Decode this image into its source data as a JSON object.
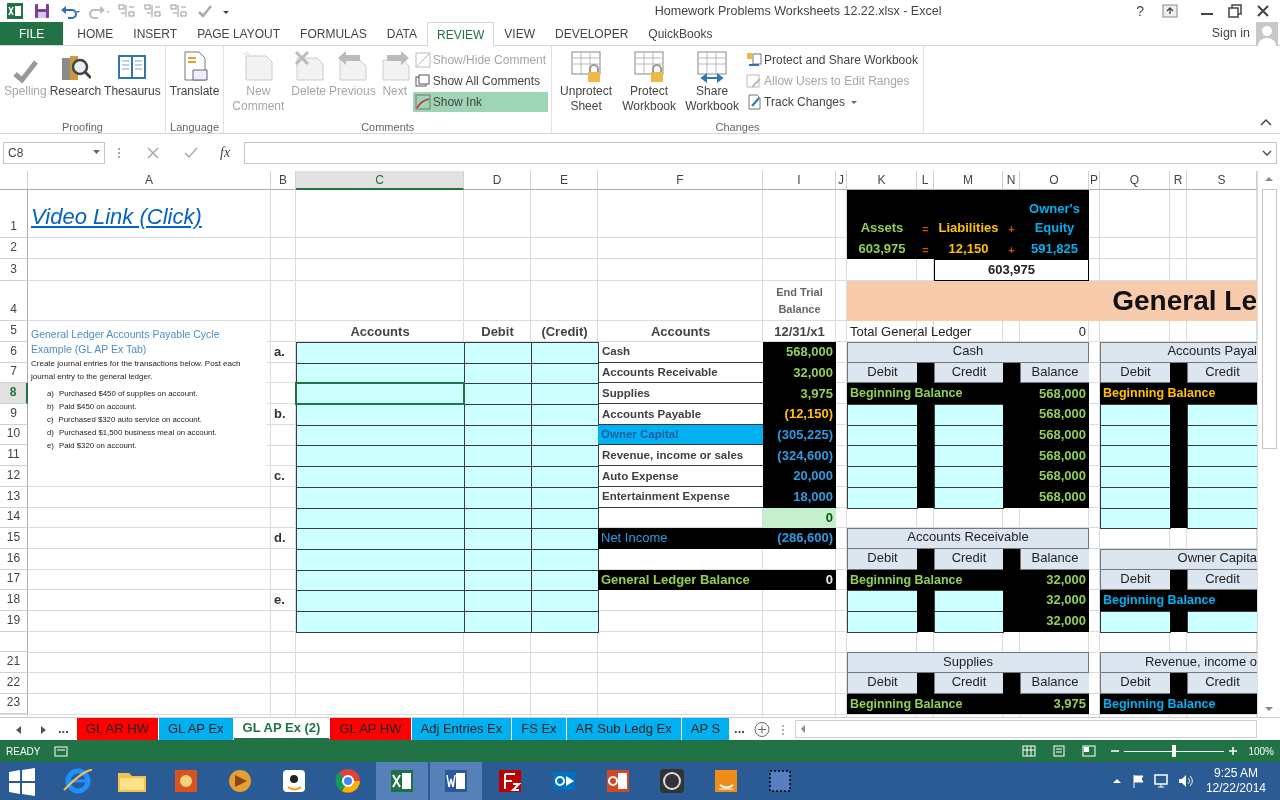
{
  "window": {
    "title": "Homework Problems Worksheets 12.22.xlsx - Excel",
    "help": "?"
  },
  "ribbon_tabs": [
    {
      "label": "FILE",
      "kind": "file",
      "selected": false
    },
    {
      "label": "HOME",
      "kind": "tab",
      "selected": false
    },
    {
      "label": "INSERT",
      "kind": "tab",
      "selected": false
    },
    {
      "label": "PAGE LAYOUT",
      "kind": "tab",
      "selected": false
    },
    {
      "label": "FORMULAS",
      "kind": "tab",
      "selected": false
    },
    {
      "label": "DATA",
      "kind": "tab",
      "selected": false
    },
    {
      "label": "REVIEW",
      "kind": "tab",
      "selected": true
    },
    {
      "label": "VIEW",
      "kind": "tab",
      "selected": false
    },
    {
      "label": "DEVELOPER",
      "kind": "tab",
      "selected": false
    },
    {
      "label": "QuickBooks",
      "kind": "tab",
      "selected": false
    }
  ],
  "account": {
    "label": "Sign in"
  },
  "ribbon_groups": [
    {
      "label": "Proofing",
      "items": [
        {
          "kind": "large",
          "label": "Spelling",
          "disabled": true
        },
        {
          "kind": "large",
          "label": "Research",
          "disabled": false
        },
        {
          "kind": "large",
          "label": "Thesaurus",
          "disabled": false
        }
      ]
    },
    {
      "label": "Language",
      "items": [
        {
          "kind": "large",
          "label": "Translate",
          "disabled": false
        }
      ]
    },
    {
      "label": "Comments",
      "items": [
        {
          "kind": "large",
          "label": "New Comment",
          "disabled": true
        },
        {
          "kind": "large",
          "label": "Delete",
          "disabled": true
        },
        {
          "kind": "large",
          "label": "Previous",
          "disabled": true
        },
        {
          "kind": "large",
          "label": "Next",
          "disabled": true
        },
        {
          "kind": "small",
          "label": "Show/Hide Comment",
          "disabled": true,
          "on": false
        },
        {
          "kind": "small",
          "label": "Show All Comments",
          "disabled": false,
          "on": false
        },
        {
          "kind": "small",
          "label": "Show Ink",
          "disabled": false,
          "on": true
        }
      ]
    },
    {
      "label": "Changes",
      "items": [
        {
          "kind": "large",
          "label": "Unprotect Sheet",
          "disabled": false
        },
        {
          "kind": "large",
          "label": "Protect Workbook",
          "disabled": false
        },
        {
          "kind": "large",
          "label": "Share Workbook",
          "disabled": false
        },
        {
          "kind": "small",
          "label": "Protect and Share Workbook",
          "disabled": false
        },
        {
          "kind": "small",
          "label": "Allow Users to Edit Ranges",
          "disabled": true
        },
        {
          "kind": "small",
          "label": "Track Changes",
          "disabled": false,
          "dropdown": true
        }
      ]
    }
  ],
  "formula_bar": {
    "name_box": "C8",
    "function_label": "fx"
  },
  "columns": [
    {
      "label": "A",
      "selected": false
    },
    {
      "label": "B",
      "selected": false
    },
    {
      "label": "C",
      "selected": true
    },
    {
      "label": "D",
      "selected": false
    },
    {
      "label": "E",
      "selected": false
    },
    {
      "label": "F",
      "selected": false
    },
    {
      "label": "I",
      "selected": false
    },
    {
      "label": "J",
      "selected": false
    },
    {
      "label": "K",
      "selected": false
    },
    {
      "label": "L",
      "selected": false
    },
    {
      "label": "M",
      "selected": false
    },
    {
      "label": "N",
      "selected": false
    },
    {
      "label": "O",
      "selected": false
    },
    {
      "label": "P",
      "selected": false
    },
    {
      "label": "Q",
      "selected": false
    },
    {
      "label": "R",
      "selected": false
    },
    {
      "label": "S",
      "selected": false
    }
  ],
  "rows": [
    {
      "label": "1",
      "selected": false,
      "cells": [
        {
          "kind": "link",
          "text": "Video Link (Click)"
        },
        {
          "kind": "blank"
        },
        {
          "kind": "blank"
        },
        {
          "kind": "blank"
        },
        {
          "kind": "blank"
        },
        {
          "kind": "blank"
        },
        {
          "kind": "blank"
        },
        {
          "kind": "blank"
        },
        {
          "kind": "eq_green",
          "text": "Assets"
        },
        {
          "kind": "eq_sign",
          "text": "="
        },
        {
          "kind": "eq_orange",
          "text": "Liabilities"
        },
        {
          "kind": "eq_sign",
          "text": "+"
        },
        {
          "kind": "eq_blue",
          "text": "Owner's Equity"
        },
        {
          "kind": "blank"
        },
        {
          "kind": "blank"
        },
        {
          "kind": "blank"
        },
        {
          "kind": "blank"
        }
      ]
    },
    {
      "label": "2",
      "selected": false,
      "cells": [
        {
          "kind": "blank"
        },
        {
          "kind": "blank"
        },
        {
          "kind": "blank"
        },
        {
          "kind": "blank"
        },
        {
          "kind": "blank"
        },
        {
          "kind": "blank"
        },
        {
          "kind": "blank"
        },
        {
          "kind": "blank"
        },
        {
          "kind": "eq_green",
          "text": "603,975"
        },
        {
          "kind": "eq_sign",
          "text": "="
        },
        {
          "kind": "eq_orange",
          "text": "12,150"
        },
        {
          "kind": "eq_sign",
          "text": "+"
        },
        {
          "kind": "eq_blue",
          "text": "591,825"
        },
        {
          "kind": "blank"
        },
        {
          "kind": "blank"
        },
        {
          "kind": "blank"
        },
        {
          "kind": "blank"
        }
      ]
    },
    {
      "label": "3",
      "selected": false,
      "cells": [
        {
          "kind": "blank"
        },
        {
          "kind": "blank"
        },
        {
          "kind": "blank"
        },
        {
          "kind": "blank"
        },
        {
          "kind": "blank"
        },
        {
          "kind": "blank"
        },
        {
          "kind": "blank"
        },
        {
          "kind": "blank"
        },
        {
          "kind": "blank"
        },
        {
          "kind": "blank"
        },
        {
          "kind": "total_box",
          "text": "603,975"
        },
        {
          "kind": "merge"
        },
        {
          "kind": "merge"
        },
        {
          "kind": "blank"
        },
        {
          "kind": "blank"
        },
        {
          "kind": "blank"
        },
        {
          "kind": "blank"
        }
      ]
    },
    {
      "label": "4",
      "selected": false,
      "cells": [
        {
          "kind": "blank"
        },
        {
          "kind": "blank"
        },
        {
          "kind": "blank"
        },
        {
          "kind": "blank"
        },
        {
          "kind": "blank"
        },
        {
          "kind": "blank"
        },
        {
          "kind": "caption",
          "text": "End Trial Balance"
        },
        {
          "kind": "blank"
        },
        {
          "kind": "banner",
          "text": "General Le"
        },
        {
          "kind": "merge"
        },
        {
          "kind": "merge"
        },
        {
          "kind": "merge"
        },
        {
          "kind": "merge"
        },
        {
          "kind": "merge"
        },
        {
          "kind": "merge"
        },
        {
          "kind": "merge"
        },
        {
          "kind": "merge"
        }
      ]
    },
    {
      "label": "5",
      "selected": false,
      "cells": [
        {
          "kind": "note"
        },
        {
          "kind": "blank"
        },
        {
          "kind": "colhead",
          "text": "Accounts"
        },
        {
          "kind": "colhead",
          "text": "Debit"
        },
        {
          "kind": "colhead",
          "text": "(Credit)"
        },
        {
          "kind": "colhead",
          "text": "Accounts"
        },
        {
          "kind": "colhead",
          "text": "12/31/x1"
        },
        {
          "kind": "blank"
        },
        {
          "kind": "plain",
          "text": "Total General Ledger"
        },
        {
          "kind": "blank"
        },
        {
          "kind": "blank"
        },
        {
          "kind": "blank"
        },
        {
          "kind": "plain_right",
          "text": "0"
        },
        {
          "kind": "blank"
        },
        {
          "kind": "blank"
        },
        {
          "kind": "blank"
        },
        {
          "kind": "blank"
        }
      ]
    },
    {
      "label": "6",
      "selected": false,
      "cells": [
        {
          "kind": "blank"
        },
        {
          "kind": "letter",
          "text": "a."
        },
        {
          "kind": "input"
        },
        {
          "kind": "input"
        },
        {
          "kind": "input"
        },
        {
          "kind": "account",
          "text": "Cash"
        },
        {
          "kind": "amount_green",
          "text": "568,000"
        },
        {
          "kind": "blank"
        },
        {
          "kind": "ledger_title",
          "text": "Cash"
        },
        {
          "kind": "merge"
        },
        {
          "kind": "merge"
        },
        {
          "kind": "merge"
        },
        {
          "kind": "merge"
        },
        {
          "kind": "blank"
        },
        {
          "kind": "ledger_title_cut",
          "text": "Accounts Payal"
        },
        {
          "kind": "merge"
        },
        {
          "kind": "merge"
        }
      ]
    },
    {
      "label": "7",
      "selected": false,
      "cells": [
        {
          "kind": "blank"
        },
        {
          "kind": "blank"
        },
        {
          "kind": "input"
        },
        {
          "kind": "input"
        },
        {
          "kind": "input"
        },
        {
          "kind": "account",
          "text": "Accounts Receivable"
        },
        {
          "kind": "amount_green",
          "text": "32,000"
        },
        {
          "kind": "blank"
        },
        {
          "kind": "ledger_col",
          "text": "Debit"
        },
        {
          "kind": "dark"
        },
        {
          "kind": "ledger_col",
          "text": "Credit"
        },
        {
          "kind": "dark"
        },
        {
          "kind": "ledger_col",
          "text": "Balance"
        },
        {
          "kind": "blank"
        },
        {
          "kind": "ledger_col",
          "text": "Debit"
        },
        {
          "kind": "dark"
        },
        {
          "kind": "ledger_col",
          "text": "Credit"
        }
      ]
    },
    {
      "label": "8",
      "selected": true,
      "cells": [
        {
          "kind": "blank"
        },
        {
          "kind": "blank"
        },
        {
          "kind": "input"
        },
        {
          "kind": "input"
        },
        {
          "kind": "input"
        },
        {
          "kind": "account",
          "text": "Supplies"
        },
        {
          "kind": "amount_green",
          "text": "3,975"
        },
        {
          "kind": "blank"
        },
        {
          "kind": "bb_green",
          "text": "Beginning Balance"
        },
        {
          "kind": "merge"
        },
        {
          "kind": "merge"
        },
        {
          "kind": "dark"
        },
        {
          "kind": "balance",
          "text": "568,000"
        },
        {
          "kind": "blank"
        },
        {
          "kind": "bb_orange",
          "text": "Beginning Balance"
        },
        {
          "kind": "merge"
        },
        {
          "kind": "merge"
        }
      ]
    },
    {
      "label": "9",
      "selected": false,
      "cells": [
        {
          "kind": "blank"
        },
        {
          "kind": "letter",
          "text": "b."
        },
        {
          "kind": "input"
        },
        {
          "kind": "input"
        },
        {
          "kind": "input"
        },
        {
          "kind": "account",
          "text": "Accounts Payable"
        },
        {
          "kind": "amount_orange",
          "text": "(12,150)"
        },
        {
          "kind": "blank"
        },
        {
          "kind": "input"
        },
        {
          "kind": "dark"
        },
        {
          "kind": "input"
        },
        {
          "kind": "dark"
        },
        {
          "kind": "balance",
          "text": "568,000"
        },
        {
          "kind": "blank"
        },
        {
          "kind": "input"
        },
        {
          "kind": "dark"
        },
        {
          "kind": "input"
        }
      ]
    },
    {
      "label": "10",
      "selected": false,
      "cells": [
        {
          "kind": "blank"
        },
        {
          "kind": "blank"
        },
        {
          "kind": "input"
        },
        {
          "kind": "input"
        },
        {
          "kind": "input"
        },
        {
          "kind": "account_highlight",
          "text": "Owner Capital"
        },
        {
          "kind": "amount_blue",
          "text": "(305,225)"
        },
        {
          "kind": "blank"
        },
        {
          "kind": "input"
        },
        {
          "kind": "dark"
        },
        {
          "kind": "input"
        },
        {
          "kind": "dark"
        },
        {
          "kind": "balance",
          "text": "568,000"
        },
        {
          "kind": "blank"
        },
        {
          "kind": "input"
        },
        {
          "kind": "dark"
        },
        {
          "kind": "input"
        }
      ]
    },
    {
      "label": "11",
      "selected": false,
      "cells": [
        {
          "kind": "blank"
        },
        {
          "kind": "blank"
        },
        {
          "kind": "input"
        },
        {
          "kind": "input"
        },
        {
          "kind": "input"
        },
        {
          "kind": "account",
          "text": "Revenue, income or sales"
        },
        {
          "kind": "amount_blue",
          "text": "(324,600)"
        },
        {
          "kind": "blank"
        },
        {
          "kind": "input"
        },
        {
          "kind": "dark"
        },
        {
          "kind": "input"
        },
        {
          "kind": "dark"
        },
        {
          "kind": "balance",
          "text": "568,000"
        },
        {
          "kind": "blank"
        },
        {
          "kind": "input"
        },
        {
          "kind": "dark"
        },
        {
          "kind": "input"
        }
      ]
    },
    {
      "label": "12",
      "selected": false,
      "cells": [
        {
          "kind": "blank"
        },
        {
          "kind": "letter",
          "text": "c."
        },
        {
          "kind": "input"
        },
        {
          "kind": "input"
        },
        {
          "kind": "input"
        },
        {
          "kind": "account",
          "text": "Auto Expense"
        },
        {
          "kind": "amount_blue",
          "text": "20,000"
        },
        {
          "kind": "blank"
        },
        {
          "kind": "input"
        },
        {
          "kind": "dark"
        },
        {
          "kind": "input"
        },
        {
          "kind": "dark"
        },
        {
          "kind": "balance",
          "text": "568,000"
        },
        {
          "kind": "blank"
        },
        {
          "kind": "input"
        },
        {
          "kind": "dark"
        },
        {
          "kind": "input"
        }
      ]
    },
    {
      "label": "13",
      "selected": false,
      "cells": [
        {
          "kind": "blank"
        },
        {
          "kind": "blank"
        },
        {
          "kind": "input"
        },
        {
          "kind": "input"
        },
        {
          "kind": "input"
        },
        {
          "kind": "account",
          "text": "Entertainment Expense"
        },
        {
          "kind": "amount_blue",
          "text": "18,000"
        },
        {
          "kind": "blank"
        },
        {
          "kind": "input"
        },
        {
          "kind": "dark"
        },
        {
          "kind": "input"
        },
        {
          "kind": "dark"
        },
        {
          "kind": "balance",
          "text": "568,000"
        },
        {
          "kind": "blank"
        },
        {
          "kind": "input"
        },
        {
          "kind": "dark"
        },
        {
          "kind": "input"
        }
      ]
    },
    {
      "label": "14",
      "selected": false,
      "cells": [
        {
          "kind": "blank"
        },
        {
          "kind": "blank"
        },
        {
          "kind": "input"
        },
        {
          "kind": "input"
        },
        {
          "kind": "input"
        },
        {
          "kind": "blank"
        },
        {
          "kind": "check_total",
          "text": "0"
        },
        {
          "kind": "blank"
        },
        {
          "kind": "blank"
        },
        {
          "kind": "blank"
        },
        {
          "kind": "blank"
        },
        {
          "kind": "blank"
        },
        {
          "kind": "blank"
        },
        {
          "kind": "blank"
        },
        {
          "kind": "input"
        },
        {
          "kind": "dark"
        },
        {
          "kind": "input"
        }
      ]
    },
    {
      "label": "15",
      "selected": false,
      "cells": [
        {
          "kind": "blank"
        },
        {
          "kind": "letter",
          "text": "d."
        },
        {
          "kind": "input"
        },
        {
          "kind": "input"
        },
        {
          "kind": "input"
        },
        {
          "kind": "label_blue",
          "text": "Net Income"
        },
        {
          "kind": "amount_blue",
          "text": "(286,600)"
        },
        {
          "kind": "blank"
        },
        {
          "kind": "ledger_title",
          "text": "Accounts Receivable"
        },
        {
          "kind": "merge"
        },
        {
          "kind": "merge"
        },
        {
          "kind": "merge"
        },
        {
          "kind": "merge"
        },
        {
          "kind": "blank"
        },
        {
          "kind": "blank"
        },
        {
          "kind": "blank"
        },
        {
          "kind": "blank"
        }
      ]
    },
    {
      "label": "16",
      "selected": false,
      "cells": [
        {
          "kind": "blank"
        },
        {
          "kind": "blank"
        },
        {
          "kind": "input"
        },
        {
          "kind": "input"
        },
        {
          "kind": "input"
        },
        {
          "kind": "blank"
        },
        {
          "kind": "blank"
        },
        {
          "kind": "blank"
        },
        {
          "kind": "ledger_col",
          "text": "Debit"
        },
        {
          "kind": "dark"
        },
        {
          "kind": "ledger_col",
          "text": "Credit"
        },
        {
          "kind": "dark"
        },
        {
          "kind": "ledger_col",
          "text": "Balance"
        },
        {
          "kind": "blank"
        },
        {
          "kind": "ledger_title_cut",
          "text": "Owner Capita"
        },
        {
          "kind": "merge"
        },
        {
          "kind": "merge"
        }
      ]
    },
    {
      "label": "17",
      "selected": false,
      "cells": [
        {
          "kind": "blank"
        },
        {
          "kind": "blank"
        },
        {
          "kind": "input"
        },
        {
          "kind": "input"
        },
        {
          "kind": "input"
        },
        {
          "kind": "label_green",
          "text": "General Ledger Balance"
        },
        {
          "kind": "amount_light",
          "text": "0"
        },
        {
          "kind": "blank"
        },
        {
          "kind": "bb_green",
          "text": "Beginning Balance"
        },
        {
          "kind": "merge"
        },
        {
          "kind": "merge"
        },
        {
          "kind": "dark"
        },
        {
          "kind": "balance",
          "text": "32,000"
        },
        {
          "kind": "blank"
        },
        {
          "kind": "ledger_col",
          "text": "Debit"
        },
        {
          "kind": "dark"
        },
        {
          "kind": "ledger_col",
          "text": "Credit"
        }
      ]
    },
    {
      "label": "18",
      "selected": false,
      "cells": [
        {
          "kind": "blank"
        },
        {
          "kind": "letter",
          "text": "e."
        },
        {
          "kind": "input"
        },
        {
          "kind": "input"
        },
        {
          "kind": "input"
        },
        {
          "kind": "blank"
        },
        {
          "kind": "blank"
        },
        {
          "kind": "blank"
        },
        {
          "kind": "input"
        },
        {
          "kind": "dark"
        },
        {
          "kind": "input"
        },
        {
          "kind": "dark"
        },
        {
          "kind": "balance",
          "text": "32,000"
        },
        {
          "kind": "blank"
        },
        {
          "kind": "bb_blue",
          "text": "Beginning Balance"
        },
        {
          "kind": "merge"
        },
        {
          "kind": "merge"
        }
      ]
    },
    {
      "label": "19",
      "selected": false,
      "cells": [
        {
          "kind": "blank"
        },
        {
          "kind": "blank"
        },
        {
          "kind": "input"
        },
        {
          "kind": "input"
        },
        {
          "kind": "input"
        },
        {
          "kind": "blank"
        },
        {
          "kind": "blank"
        },
        {
          "kind": "blank"
        },
        {
          "kind": "input"
        },
        {
          "kind": "dark"
        },
        {
          "kind": "input"
        },
        {
          "kind": "dark"
        },
        {
          "kind": "balance",
          "text": "32,000"
        },
        {
          "kind": "blank"
        },
        {
          "kind": "input"
        },
        {
          "kind": "dark"
        },
        {
          "kind": "input"
        }
      ]
    },
    {
      "selected": false,
      "cells": [
        {
          "kind": "blank"
        },
        {
          "kind": "blank"
        },
        {
          "kind": "blank"
        },
        {
          "kind": "blank"
        },
        {
          "kind": "blank"
        },
        {
          "kind": "blank"
        },
        {
          "kind": "blank"
        },
        {
          "kind": "blank"
        },
        {
          "kind": "blank"
        },
        {
          "kind": "blank"
        },
        {
          "kind": "blank"
        },
        {
          "kind": "blank"
        },
        {
          "kind": "blank"
        },
        {
          "kind": "blank"
        },
        {
          "kind": "blank"
        },
        {
          "kind": "blank"
        },
        {
          "kind": "blank"
        }
      ]
    },
    {
      "label": "21",
      "selected": false,
      "cells": [
        {
          "kind": "blank"
        },
        {
          "kind": "blank"
        },
        {
          "kind": "blank"
        },
        {
          "kind": "blank"
        },
        {
          "kind": "blank"
        },
        {
          "kind": "blank"
        },
        {
          "kind": "blank"
        },
        {
          "kind": "blank"
        },
        {
          "kind": "ledger_title",
          "text": "Supplies"
        },
        {
          "kind": "merge"
        },
        {
          "kind": "merge"
        },
        {
          "kind": "merge"
        },
        {
          "kind": "merge"
        },
        {
          "kind": "blank"
        },
        {
          "kind": "ledger_title_cut",
          "text": "Revenue, income o"
        },
        {
          "kind": "merge"
        },
        {
          "kind": "merge"
        }
      ]
    },
    {
      "label": "22",
      "selected": false,
      "cells": [
        {
          "kind": "blank"
        },
        {
          "kind": "blank"
        },
        {
          "kind": "blank"
        },
        {
          "kind": "blank"
        },
        {
          "kind": "blank"
        },
        {
          "kind": "blank"
        },
        {
          "kind": "blank"
        },
        {
          "kind": "blank"
        },
        {
          "kind": "ledger_col",
          "text": "Debit"
        },
        {
          "kind": "dark"
        },
        {
          "kind": "ledger_col",
          "text": "Credit"
        },
        {
          "kind": "dark"
        },
        {
          "kind": "ledger_col",
          "text": "Balance"
        },
        {
          "kind": "blank"
        },
        {
          "kind": "ledger_col",
          "text": "Debit"
        },
        {
          "kind": "dark"
        },
        {
          "kind": "ledger_col",
          "text": "Credit"
        }
      ]
    },
    {
      "label": "23",
      "selected": false,
      "cells": [
        {
          "kind": "blank"
        },
        {
          "kind": "blank"
        },
        {
          "kind": "blank"
        },
        {
          "kind": "blank"
        },
        {
          "kind": "blank"
        },
        {
          "kind": "blank"
        },
        {
          "kind": "blank"
        },
        {
          "kind": "blank"
        },
        {
          "kind": "bb_green",
          "text": "Beginning Balance"
        },
        {
          "kind": "merge"
        },
        {
          "kind": "merge"
        },
        {
          "kind": "dark"
        },
        {
          "kind": "balance",
          "text": "3,975"
        },
        {
          "kind": "blank"
        },
        {
          "kind": "bb_blue",
          "text": "Beginning Balance"
        },
        {
          "kind": "merge"
        },
        {
          "kind": "merge"
        }
      ]
    }
  ],
  "note": {
    "title": "General Ledger Accounts Payable Cycle Example (GL AP Ex Tab)",
    "body": "Create journal entries for the transactions below. Post each journal entry to the general ledger.",
    "items": [
      {
        "marker": "a)",
        "text": "Purchased $450 of supplies on account."
      },
      {
        "marker": "b)",
        "text": "Paid $450 on account."
      },
      {
        "marker": "c)",
        "text": "Purchased $320 auto service on account."
      },
      {
        "marker": "d)",
        "text": "Purchased $1,500 business meal on account."
      },
      {
        "marker": "e)",
        "text": "Paid $320 on account."
      }
    ]
  },
  "sheet_tabs": {
    "more_left": "...",
    "more_right": "...",
    "tabs": [
      {
        "label": "GL AR HW",
        "color": "#ff0000",
        "selected": false
      },
      {
        "label": "GL AP Ex",
        "color": "#00b0f0",
        "selected": false
      },
      {
        "label": "GL AP Ex (2)",
        "selected": true
      },
      {
        "label": "GL AP HW",
        "color": "#ff0000",
        "selected": false
      },
      {
        "label": "Adj Entries Ex",
        "color": "#00b0f0",
        "selected": false
      },
      {
        "label": "FS Ex",
        "color": "#00b0f0",
        "selected": false
      },
      {
        "label": "AR Sub Ledg Ex",
        "color": "#00b0f0",
        "selected": false
      },
      {
        "label": "AP S",
        "color": "#00b0f0",
        "selected": false
      }
    ]
  },
  "status_bar": {
    "mode": "READY",
    "zoom": "100%",
    "level": 0.5
  },
  "taskbar": {
    "apps": [
      {
        "active": false
      },
      {
        "active": false
      },
      {
        "active": false
      },
      {
        "active": false
      },
      {
        "active": false
      },
      {
        "active": false
      },
      {
        "active": true
      },
      {
        "active": true
      },
      {
        "active": false
      },
      {
        "active": false
      },
      {
        "active": false
      },
      {
        "active": false
      },
      {
        "active": false
      },
      {
        "active": false
      }
    ],
    "time": "9:25 AM",
    "date": "12/22/2014"
  }
}
